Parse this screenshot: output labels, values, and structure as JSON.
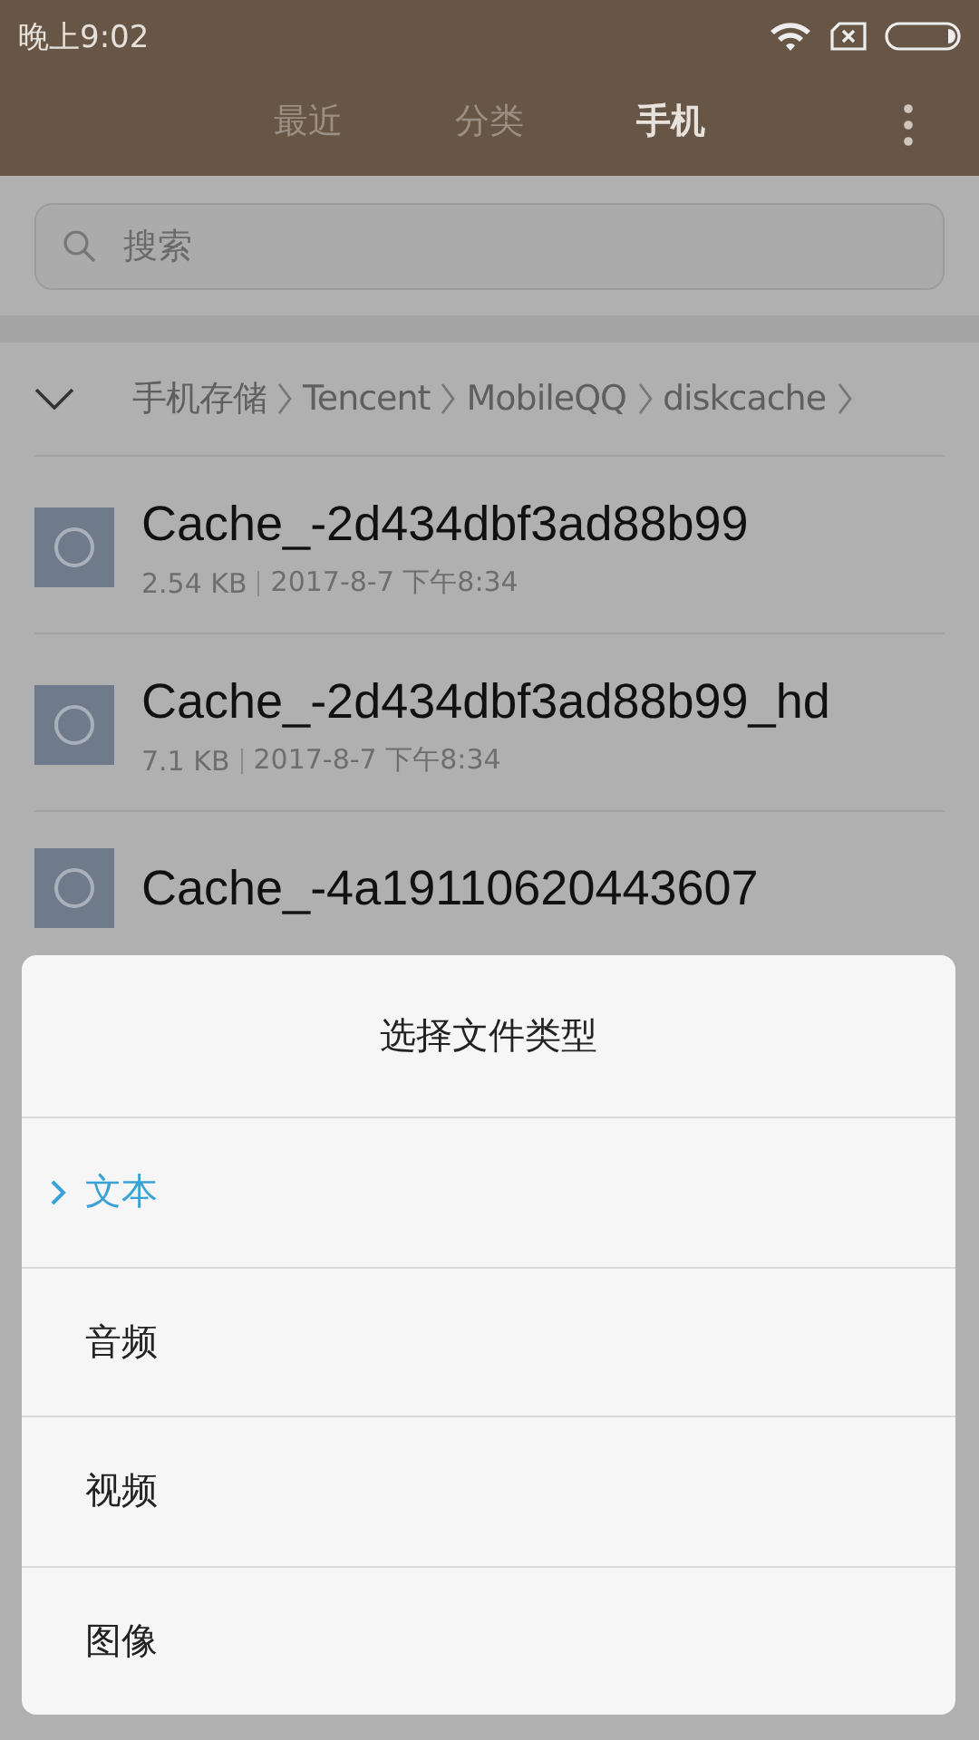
{
  "status_bar": {
    "time": "晚上9:02"
  },
  "tabs": [
    {
      "label": "最近",
      "selected": false
    },
    {
      "label": "分类",
      "selected": false
    },
    {
      "label": "手机",
      "selected": true
    }
  ],
  "search": {
    "placeholder": "搜索"
  },
  "breadcrumb": [
    "手机存储",
    "Tencent",
    "MobileQQ",
    "diskcache"
  ],
  "files": [
    {
      "name": "Cache_-2d434dbf3ad88b99",
      "size": "2.54 KB",
      "date": "2017-8-7 下午8:34"
    },
    {
      "name": "Cache_-2d434dbf3ad88b99_hd",
      "size": "7.1 KB",
      "date": "2017-8-7 下午8:34"
    },
    {
      "name": "Cache_-4a19110620443607"
    }
  ],
  "dialog": {
    "title": "选择文件类型",
    "options": [
      {
        "label": "文本",
        "selected": true
      },
      {
        "label": "音频",
        "selected": false
      },
      {
        "label": "视频",
        "selected": false
      },
      {
        "label": "图像",
        "selected": false
      }
    ]
  }
}
